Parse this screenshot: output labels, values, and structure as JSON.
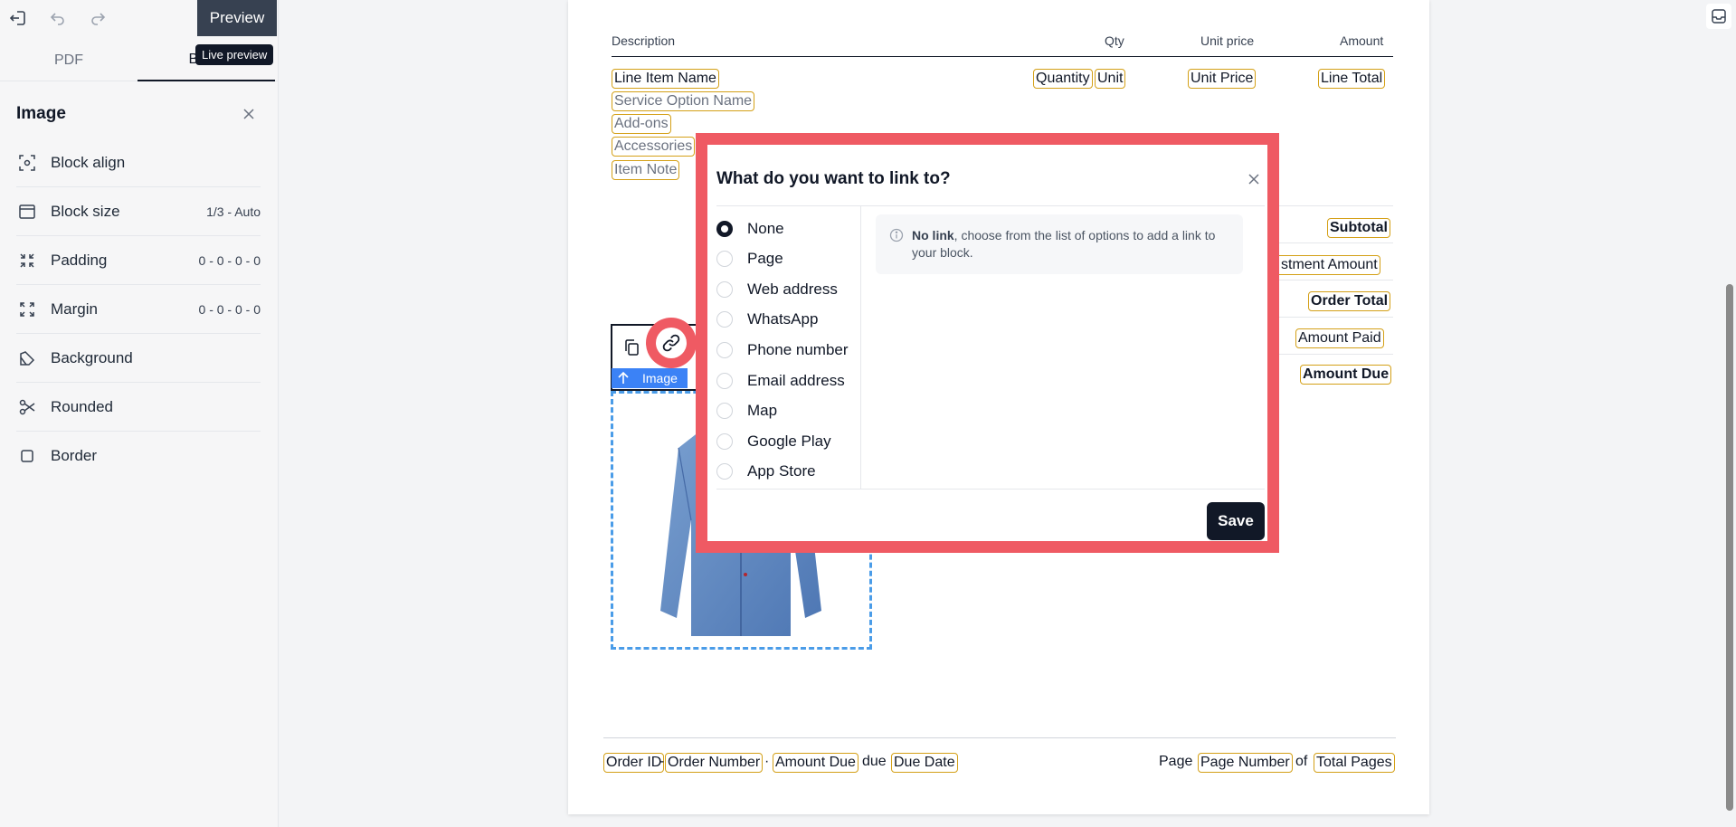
{
  "topbar": {
    "exit_icon": "exit-icon",
    "undo_icon": "undo-icon",
    "redo_icon": "redo-icon",
    "preview_label": "Preview",
    "tooltip": "Live preview"
  },
  "tabs": [
    {
      "label": "PDF"
    },
    {
      "label": "Block"
    }
  ],
  "panel": {
    "title": "Image",
    "close_icon": "close-icon",
    "properties": [
      {
        "label": "Block align",
        "value": "",
        "icon": "block-align-icon"
      },
      {
        "label": "Block size",
        "value": "1/3 - Auto",
        "icon": "block-size-icon"
      },
      {
        "label": "Padding",
        "value": "0 - 0 - 0 - 0",
        "icon": "padding-icon"
      },
      {
        "label": "Margin",
        "value": "0 - 0 - 0 - 0",
        "icon": "margin-icon"
      },
      {
        "label": "Background",
        "value": "",
        "icon": "background-icon"
      },
      {
        "label": "Rounded",
        "value": "",
        "icon": "rounded-icon"
      },
      {
        "label": "Border",
        "value": "",
        "icon": "border-icon"
      }
    ]
  },
  "document": {
    "columns": [
      "Description",
      "Qty",
      "Unit price",
      "Amount"
    ],
    "line_item": {
      "name": "Line Item Name",
      "service": "Service Option Name",
      "addons": "Add-ons",
      "accessories": "Accessories",
      "note": "Item Note",
      "quantity": "Quantity",
      "unit": "Unit",
      "unit_price": "Unit Price",
      "line_total": "Line Total"
    },
    "summary": [
      "Subtotal",
      "stment Amount",
      "Order Total",
      "Amount Paid",
      "Amount Due"
    ],
    "image_block": {
      "label": "Image",
      "copy_icon": "copy-icon",
      "link_icon": "link-icon",
      "upload_icon": "arrow-up-icon"
    },
    "footer": {
      "order_id": "Order ID",
      "sep1": "-",
      "order_number": "Order Number",
      "sep2": "·",
      "amount_due": "Amount Due",
      "due_word": "due",
      "due_date": "Due Date",
      "page_word": "Page",
      "page_number": "Page Number",
      "of_word": "of",
      "total_pages": "Total Pages"
    }
  },
  "modal": {
    "title": "What do you want to link to?",
    "options": [
      "None",
      "Page",
      "Web address",
      "WhatsApp",
      "Phone number",
      "Email address",
      "Map",
      "Google Play",
      "App Store"
    ],
    "selected": "None",
    "info_bold": "No link",
    "info_text": ", choose from the list of options to add a link to your block.",
    "save_label": "Save"
  },
  "colors": {
    "highlight": "#ef5a63",
    "tag_border": "#d4a017",
    "image_label": "#3b82f6",
    "dark": "#111827"
  }
}
